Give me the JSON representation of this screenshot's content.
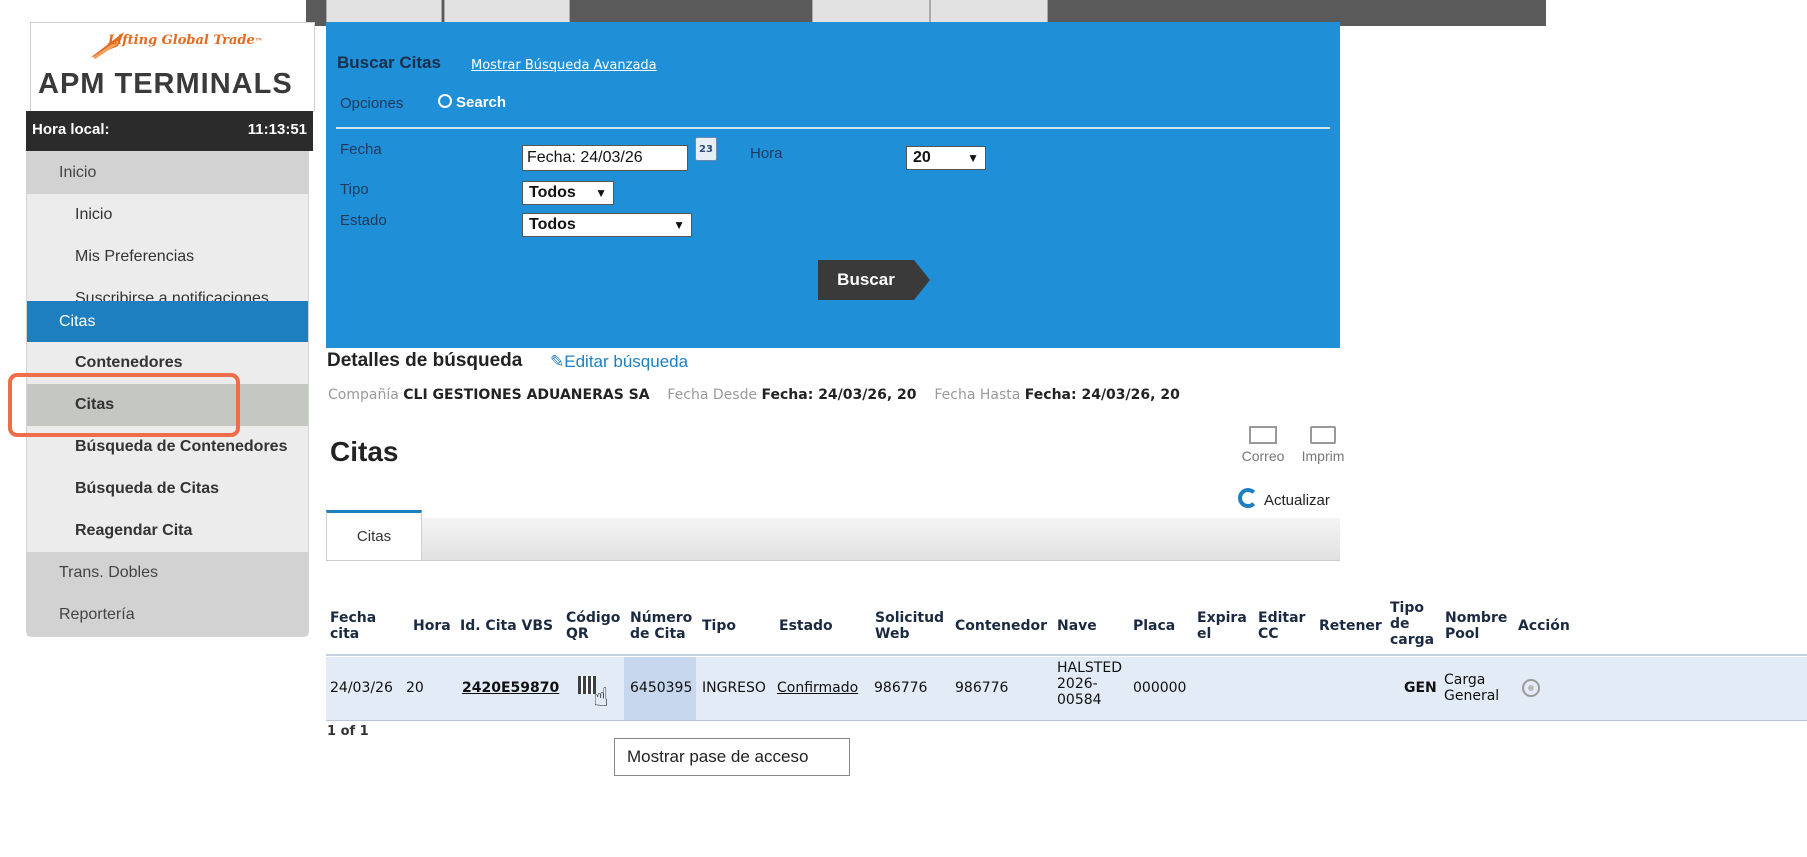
{
  "top_tabs": [
    "",
    "",
    "",
    ""
  ],
  "brand": {
    "tagline": "Lifting Global Trade",
    "tagline_mark": "™",
    "name": "APM TERMINALS"
  },
  "clock": {
    "label": "Hora local:",
    "time": "11:13:51"
  },
  "sidebar": {
    "inicio_section": "Inicio",
    "inicio_items": [
      "Inicio",
      "Mis Preferencias",
      "Suscribirse a notificaciones"
    ],
    "citas_section": "Citas",
    "citas_items": [
      "Contenedores",
      "Citas",
      "Búsqueda de Contenedores",
      "Búsqueda de Citas",
      "Reagendar Cita"
    ],
    "trans_section": "Trans. Dobles",
    "report_section": "Reportería"
  },
  "search": {
    "title": "Buscar Citas",
    "advanced_link": "Mostrar Búsqueda Avanzada",
    "options_label": "Opciones",
    "radio_label": "Search",
    "fecha_label": "Fecha",
    "fecha_value": "Fecha: 24/03/26",
    "calendar_text": "23",
    "hora_label": "Hora",
    "hora_value": "20",
    "tipo_label": "Tipo",
    "tipo_value": "Todos",
    "estado_label": "Estado",
    "estado_value": "Todos",
    "button": "Buscar"
  },
  "details": {
    "title": "Detalles de búsqueda",
    "edit": "Editar búsqueda",
    "company_label": "Compañía",
    "company_value": "CLI GESTIONES ADUANERAS SA",
    "desde_label": "Fecha Desde",
    "desde_value": "Fecha: 24/03/26, 20",
    "hasta_label": "Fecha Hasta",
    "hasta_value": "Fecha: 24/03/26, 20"
  },
  "results": {
    "heading": "Citas",
    "mail": "Correo",
    "print": "Imprim",
    "refresh": "Actualizar",
    "tab": "Citas",
    "pager": "1 of 1"
  },
  "table": {
    "headers": {
      "fecha": [
        "Fecha",
        "cita"
      ],
      "hora": "Hora",
      "id": "Id. Cita VBS",
      "qr": [
        "Código",
        "QR"
      ],
      "numero": [
        "Número",
        "de Cita"
      ],
      "tipo": "Tipo",
      "estado": "Estado",
      "solicitud": [
        "Solicitud",
        "Web"
      ],
      "contenedor": "Contenedor",
      "nave": "Nave",
      "placa": "Placa",
      "expira": [
        "Expira",
        "el"
      ],
      "editar": [
        "Editar",
        "CC"
      ],
      "retener": "Retener",
      "tipo_carga": [
        "Tipo",
        "de",
        "carga"
      ],
      "pool": [
        "Nombre",
        "Pool"
      ],
      "accion": "Acción"
    },
    "row": {
      "fecha": "24/03/26",
      "hora": "20",
      "id": "2420E59870",
      "numero": "6450395",
      "tipo": "INGRESO",
      "estado": "Confirmado",
      "solicitud": "986776",
      "contenedor": "986776",
      "nave": [
        "HALSTED",
        "2026-",
        "00584"
      ],
      "placa": "000000",
      "tipo_carga": "GEN",
      "pool": [
        "Carga",
        "General"
      ]
    }
  },
  "tooltip": "Mostrar pase de acceso"
}
